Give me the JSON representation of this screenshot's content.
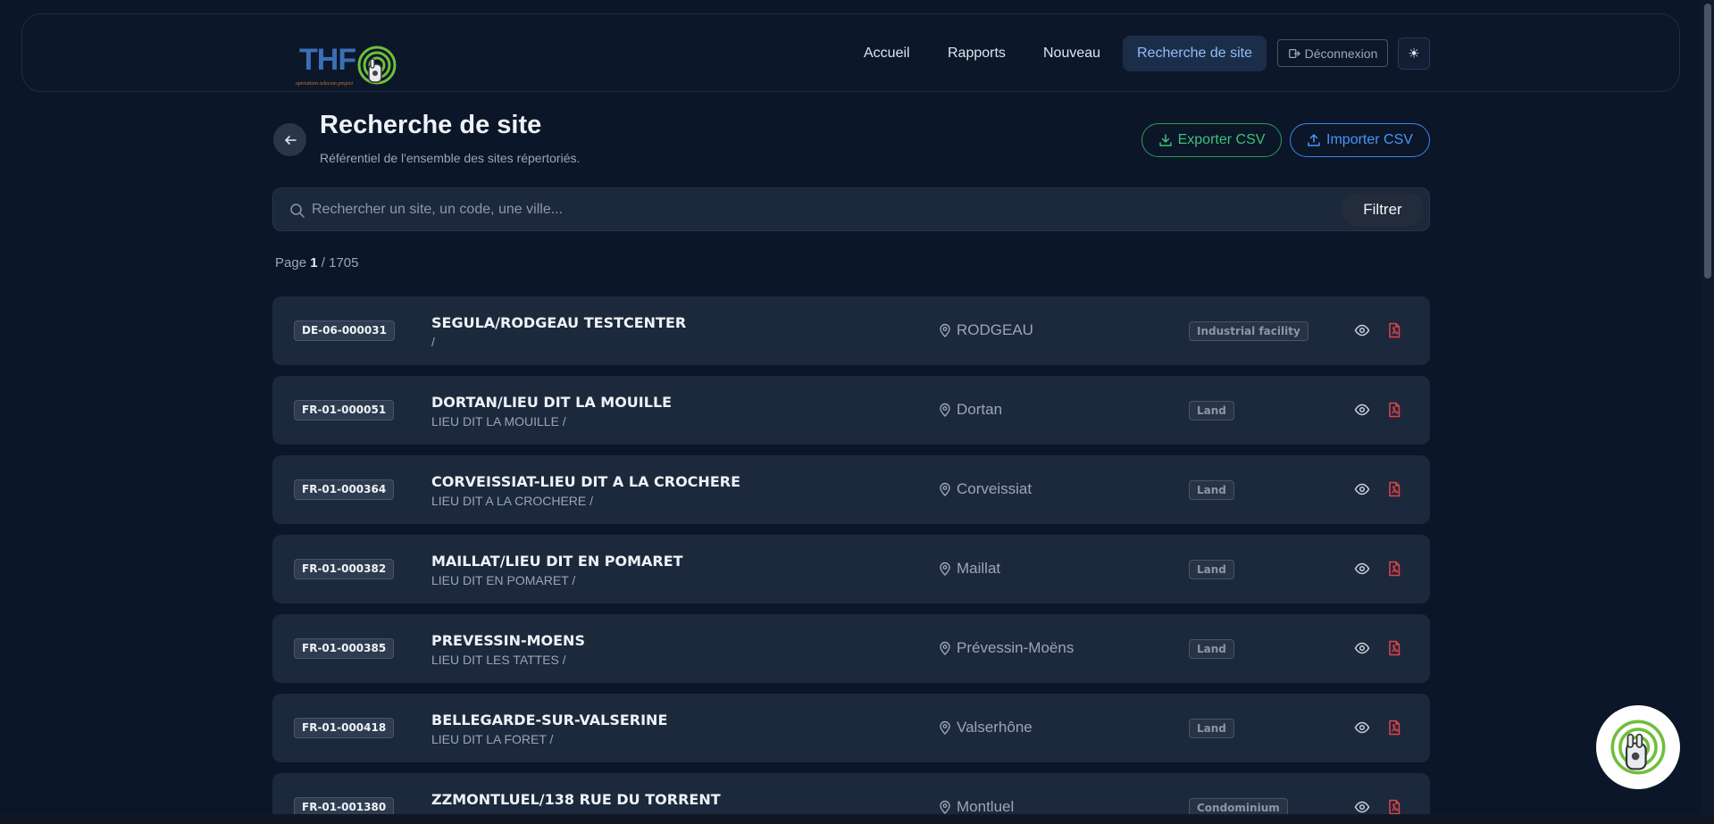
{
  "nav": {
    "logo_text": "THF",
    "logo_tagline": "operations telecom project",
    "links": [
      {
        "label": "Accueil",
        "active": false
      },
      {
        "label": "Rapports",
        "active": false
      },
      {
        "label": "Nouveau",
        "active": false
      },
      {
        "label": "Recherche de site",
        "active": true
      }
    ],
    "logout_label": "Déconnexion",
    "theme_icon": "☀"
  },
  "header": {
    "title": "Recherche de site",
    "subtitle": "Référentiel de l'ensemble des sites répertoriés.",
    "export_label": "Exporter CSV",
    "import_label": "Importer CSV"
  },
  "search": {
    "placeholder": "Rechercher un site, un code, une ville...",
    "filter_label": "Filtrer"
  },
  "pager": {
    "prefix": "Page",
    "current": "1",
    "total": "/ 1705"
  },
  "sites": [
    {
      "code": "DE-06-000031",
      "name": "SEGULA/RODGEAU TESTCENTER",
      "address": "/",
      "city": "RODGEAU",
      "type": "Industrial facility"
    },
    {
      "code": "FR-01-000051",
      "name": "DORTAN/LIEU DIT LA MOUILLE",
      "address": "LIEU DIT LA MOUILLE /",
      "city": "Dortan",
      "type": "Land"
    },
    {
      "code": "FR-01-000364",
      "name": "CORVEISSIAT-LIEU DIT A LA CROCHERE",
      "address": "LIEU DIT A LA CROCHERE /",
      "city": "Corveissiat",
      "type": "Land"
    },
    {
      "code": "FR-01-000382",
      "name": "MAILLAT/LIEU DIT EN POMARET",
      "address": "LIEU DIT EN POMARET /",
      "city": "Maillat",
      "type": "Land"
    },
    {
      "code": "FR-01-000385",
      "name": "PREVESSIN-MOENS",
      "address": "LIEU DIT LES TATTES /",
      "city": "Prévessin-Moëns",
      "type": "Land"
    },
    {
      "code": "FR-01-000418",
      "name": "BELLEGARDE-SUR-VALSERINE",
      "address": "LIEU DIT LA FORET /",
      "city": "Valserhône",
      "type": "Land"
    },
    {
      "code": "FR-01-001380",
      "name": "ZZMONTLUEL/138 RUE DU TORRENT",
      "address": "",
      "city": "Montluel",
      "type": "Condominium"
    }
  ],
  "colors": {
    "background": "#0b1628",
    "card": "#1c283b",
    "accent_blue": "#4a95f5",
    "accent_green": "#3ec277",
    "pdf_red": "#e0434b"
  }
}
